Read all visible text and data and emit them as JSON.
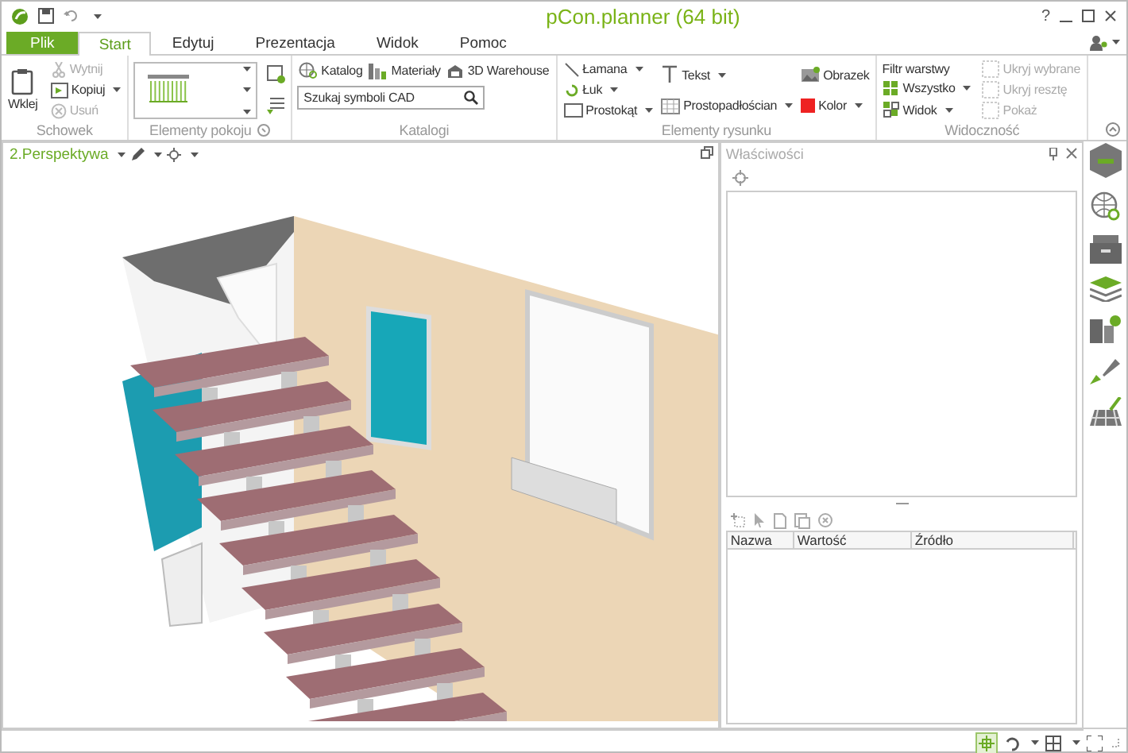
{
  "window": {
    "title": "pCon.planner (64 bit)",
    "help": "?"
  },
  "tabs": [
    {
      "label": "Plik",
      "kind": "file",
      "selected": false
    },
    {
      "label": "Start",
      "kind": "tab",
      "selected": true
    },
    {
      "label": "Edytuj",
      "kind": "tab",
      "selected": false
    },
    {
      "label": "Prezentacja",
      "kind": "tab",
      "selected": false
    },
    {
      "label": "Widok",
      "kind": "tab",
      "selected": false
    },
    {
      "label": "Pomoc",
      "kind": "tab",
      "selected": false
    }
  ],
  "ribbon": {
    "clipboard": {
      "label": "Schowek",
      "paste": "Wklej",
      "items": [
        {
          "label": "Wytnij",
          "disabled": true,
          "dropdown": false
        },
        {
          "label": "Kopiuj",
          "disabled": false,
          "dropdown": true
        },
        {
          "label": "Usuń",
          "disabled": true,
          "dropdown": false
        }
      ]
    },
    "room_elements": {
      "label": "Elementy pokoju"
    },
    "catalogs": {
      "label": "Katalogi",
      "items": [
        {
          "label": "Katalog"
        },
        {
          "label": "Materiały"
        },
        {
          "label": "3D Warehouse"
        }
      ],
      "search": {
        "placeholder": "Szukaj symboli CAD"
      }
    },
    "drawing": {
      "label": "Elementy rysunku",
      "columns": [
        [
          {
            "label": "Łamana",
            "dropdown": true
          },
          {
            "label": "Łuk",
            "dropdown": true
          },
          {
            "label": "Prostokąt",
            "dropdown": true
          }
        ],
        [
          {
            "label": "Tekst",
            "dropdown": true
          },
          {
            "label": "Prostopadłościan",
            "dropdown": true
          }
        ],
        [
          {
            "label": "Obrazek",
            "dropdown": false
          },
          {
            "label": "Kolor",
            "dropdown": true,
            "color": "#ee2222"
          }
        ]
      ]
    },
    "visibility": {
      "label": "Widoczność",
      "filter_label": "Filtr warstwy",
      "items": [
        {
          "label": "Wszystko",
          "disabled": false,
          "dropdown": true
        },
        {
          "label": "Widok",
          "disabled": false,
          "dropdown": true
        }
      ],
      "actions": [
        {
          "label": "Ukryj wybrane",
          "disabled": true
        },
        {
          "label": "Ukryj resztę",
          "disabled": true
        },
        {
          "label": "Pokaż",
          "disabled": true
        }
      ]
    }
  },
  "viewport": {
    "label": "2.Perspektywa"
  },
  "properties": {
    "title": "Właściwości",
    "columns": [
      "Nazwa",
      "Wartość",
      "Źródło"
    ]
  }
}
